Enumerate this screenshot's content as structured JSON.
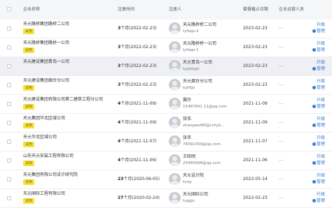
{
  "table": {
    "headers": {
      "company": "企业名称",
      "reg_time": "注册时间",
      "registrant": "注册人",
      "expiry": "套餐截止日期",
      "operators": "企业运营人员"
    },
    "rows": [
      {
        "company": "天元路桥集团路桥二公司",
        "tag": "试用",
        "time_bold": "3",
        "time_rest": "个月(2022-02-23)",
        "reg_name": "天元路桥桥二公司",
        "reg_account": "tyfqqs-2",
        "expiry": "2023-02-23",
        "ops": "---",
        "action_top": "升级",
        "action_bottom": "管理"
      },
      {
        "company": "天元路桥集团路桥一公司",
        "tag": "试用",
        "time_bold": "3",
        "time_rest": "个月(2022-02-23)",
        "reg_name": "天元路桥桥一公司",
        "reg_account": "tyfqqs-1",
        "expiry": "2023-02-23",
        "ops": "---",
        "action_top": "升级",
        "action_bottom": "管理"
      },
      {
        "company": "天元建设集团青岛一公司",
        "tag": "",
        "time_bold": "3",
        "time_rest": "个月(2022-02-23)",
        "reg_name": "天元青岛一公司",
        "reg_account": "tyjqdygs",
        "expiry": "2023-02-23",
        "ops": "---",
        "action_top": "升级",
        "action_bottom": "管理"
      },
      {
        "company": "天元建设集团烟台分公司",
        "tag": "试用",
        "time_bold": "3",
        "time_rest": "个月(2022-02-23)",
        "reg_name": "天元烟台分公司",
        "reg_account": "tyjtfgs",
        "expiry": "2023-02-23",
        "ops": "---",
        "action_top": "升级",
        "action_bottom": "管理"
      },
      {
        "company": "天元建设集团有限公司第二建筑工程分公司",
        "tag": "试用",
        "time_bold": "4",
        "time_rest": "个月(2021-11-09)",
        "reg_name": "冀玲",
        "reg_account": "15487841 11@qq.com",
        "expiry": "2021-11-09",
        "ops": "---",
        "action_top": "升级",
        "action_bottom": "管理"
      },
      {
        "company": "天元集团华北区域公司",
        "tag": "试用",
        "time_bold": "4",
        "time_rest": "个月(2021-11-09)",
        "reg_name": "张伟",
        "reg_account": "zhangwei80@cntyjt...",
        "expiry": "2021-11-09",
        "ops": "---",
        "action_top": "升级",
        "action_bottom": "管理"
      },
      {
        "company": "天元华北区域公司",
        "tag": "试用",
        "time_bold": "4",
        "time_rest": "个月(2021-11-07)",
        "reg_name": "张伟",
        "reg_account": "78392359@qq.com",
        "expiry": "2021-11-07",
        "ops": "---",
        "action_top": "升级",
        "action_bottom": "管理"
      },
      {
        "company": "山东天元安装工程有限公司",
        "tag": "试用",
        "time_bold": "4",
        "time_rest": "个月(2021-11-06)",
        "reg_name": "王晓明",
        "reg_account": "25465698@qq.com",
        "expiry": "2021-11-06",
        "ops": "---",
        "action_top": "升级",
        "action_bottom": "管理"
      },
      {
        "company": "天元集团有限公司设计研究院",
        "tag": "试用",
        "time_bold": "23",
        "time_rest": "个月(2020-06-05)",
        "reg_name": "天元设计院",
        "reg_account": "tysjy",
        "expiry": "2022-05-14",
        "ops": "---",
        "action_top": "升级",
        "action_bottom": "管理"
      },
      {
        "company": "天元国际工程有限公司",
        "tag": "试用",
        "time_bold": "27",
        "time_rest": "个月(2020-02-24)",
        "reg_name": "天元国际公司",
        "reg_account": "tygjgs",
        "expiry": "2022-02-23",
        "ops": "---",
        "action_top": "升级",
        "action_bottom": "管理"
      }
    ]
  }
}
